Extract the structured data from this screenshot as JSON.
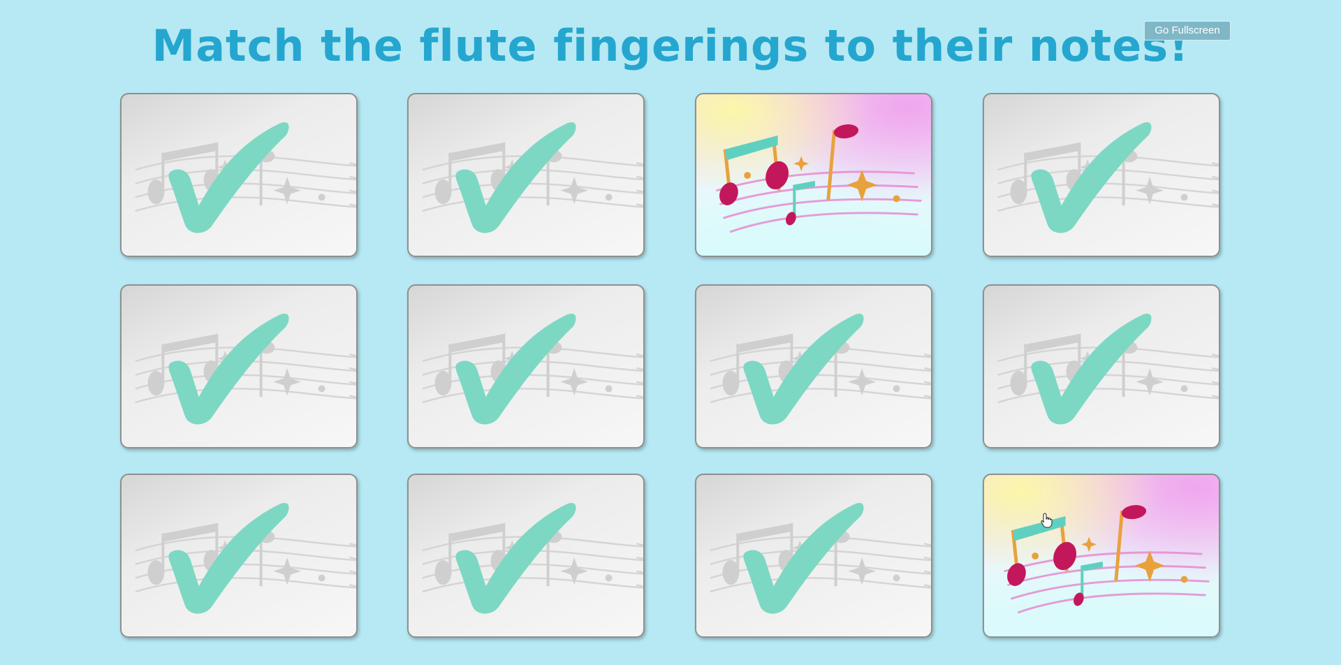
{
  "game": {
    "title": "Match the flute fingerings to their notes!",
    "fullscreen_label": "Go Fullscreen",
    "cards": [
      {
        "state": "matched"
      },
      {
        "state": "matched"
      },
      {
        "state": "facedown"
      },
      {
        "state": "matched"
      },
      {
        "state": "matched"
      },
      {
        "state": "matched"
      },
      {
        "state": "matched"
      },
      {
        "state": "matched"
      },
      {
        "state": "matched"
      },
      {
        "state": "matched"
      },
      {
        "state": "matched"
      },
      {
        "state": "facedown"
      }
    ]
  },
  "colors": {
    "background": "#b6e9f4",
    "title": "#25a6cf",
    "checkmark": "#7cd8c3",
    "note_magenta": "#c2185b",
    "note_stem": "#e8a13c",
    "staff_lines": "#e58ccf"
  },
  "icons": {
    "matched_card": "checkmark-icon",
    "facedown_card": "music-notes-icon",
    "cursor": "hand-pointer-icon"
  }
}
